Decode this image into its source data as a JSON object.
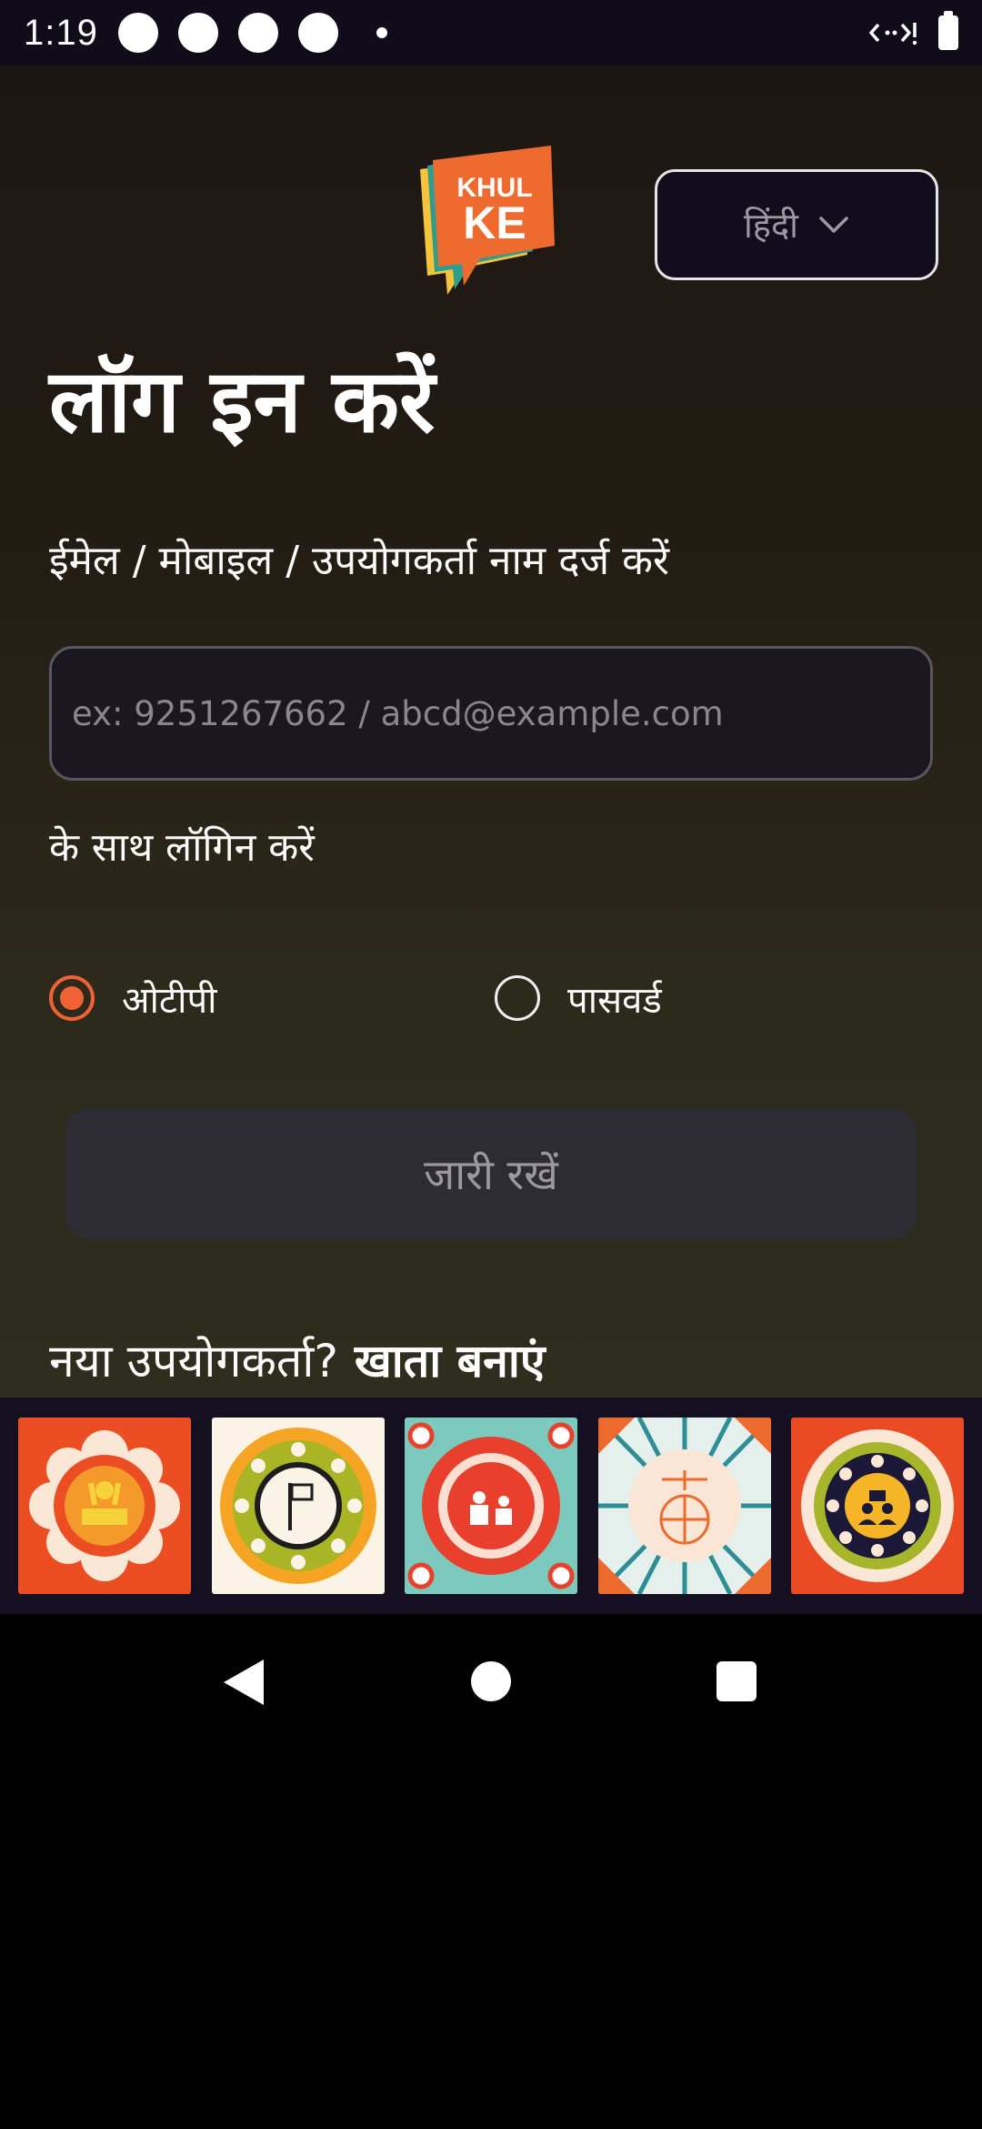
{
  "status_bar": {
    "time": "1:19"
  },
  "header": {
    "logo_text_line1": "KHUL",
    "logo_text_line2": "KE",
    "language": "हिंदी"
  },
  "login": {
    "title": "लॉग इन करें",
    "identifier_label": "ईमेल / मोबाइल / उपयोगकर्ता नाम दर्ज करें",
    "identifier_value": "",
    "identifier_placeholder": "ex: 9251267662 / abcd@example.com",
    "login_with_label": "के साथ लॉगिन करें",
    "options": [
      {
        "label": "ओटीपी",
        "selected": true
      },
      {
        "label": "पासवर्ड",
        "selected": false
      }
    ],
    "continue_label": "जारी रखें",
    "new_user_text": "नया उपयोगकर्ता?",
    "create_account_label": "खाता बनाएं"
  },
  "art_strip": {
    "tiles": [
      "protest-art-icon",
      "flag-art-icon",
      "discussion-art-icon",
      "justice-globe-art-icon",
      "community-meeting-art-icon"
    ]
  },
  "colors": {
    "accent": "#f06236",
    "background_top": "#1d1714",
    "background_bottom": "#2f2d1d",
    "button_disabled": "#2e2c33"
  }
}
